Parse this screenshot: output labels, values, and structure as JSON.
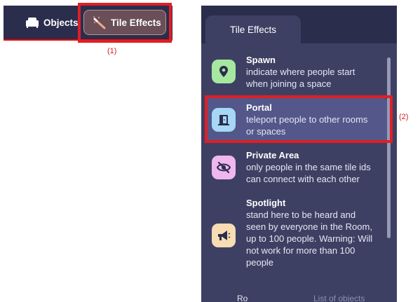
{
  "toolbar": {
    "objects_label": "Objects",
    "objects_icon": "sofa-icon",
    "tile_effects_label": "Tile Effects",
    "tile_effects_icon": "magic-wand-icon"
  },
  "annotations": {
    "one": "(1)",
    "two": "(2)"
  },
  "panel": {
    "tab_label": "Tile Effects",
    "items": [
      {
        "title": "Spawn",
        "desc_lines": [
          "indicate where people start",
          "when joining a space"
        ],
        "icon": "location-pin-icon",
        "icon_bg": "#a7e8a0",
        "selected": false
      },
      {
        "title": "Portal",
        "desc_lines": [
          "teleport people to other rooms",
          "or spaces"
        ],
        "icon": "door-icon",
        "icon_bg": "#a6d7f5",
        "selected": true
      },
      {
        "title": "Private Area",
        "desc_lines": [
          "only people in the same tile ids",
          "can connect with each other"
        ],
        "icon": "eye-slash-icon",
        "icon_bg": "#f0b7ef",
        "selected": false
      },
      {
        "title": "Spotlight",
        "desc_lines": [
          "stand here to be heard and",
          "seen by everyone in the Room,",
          "up to 100 people. Warning: Will",
          "not work for more than 100",
          "people"
        ],
        "icon": "megaphone-icon",
        "icon_bg": "#f7dcb4",
        "selected": false
      }
    ],
    "bottom_tab_left": "Ro",
    "bottom_tab_right": "List of objects"
  },
  "colors": {
    "panel_bg": "#2b2d4d",
    "panel_body_bg": "#3d4063",
    "selected_bg": "#53578a",
    "annotation_red": "#e01e25"
  }
}
